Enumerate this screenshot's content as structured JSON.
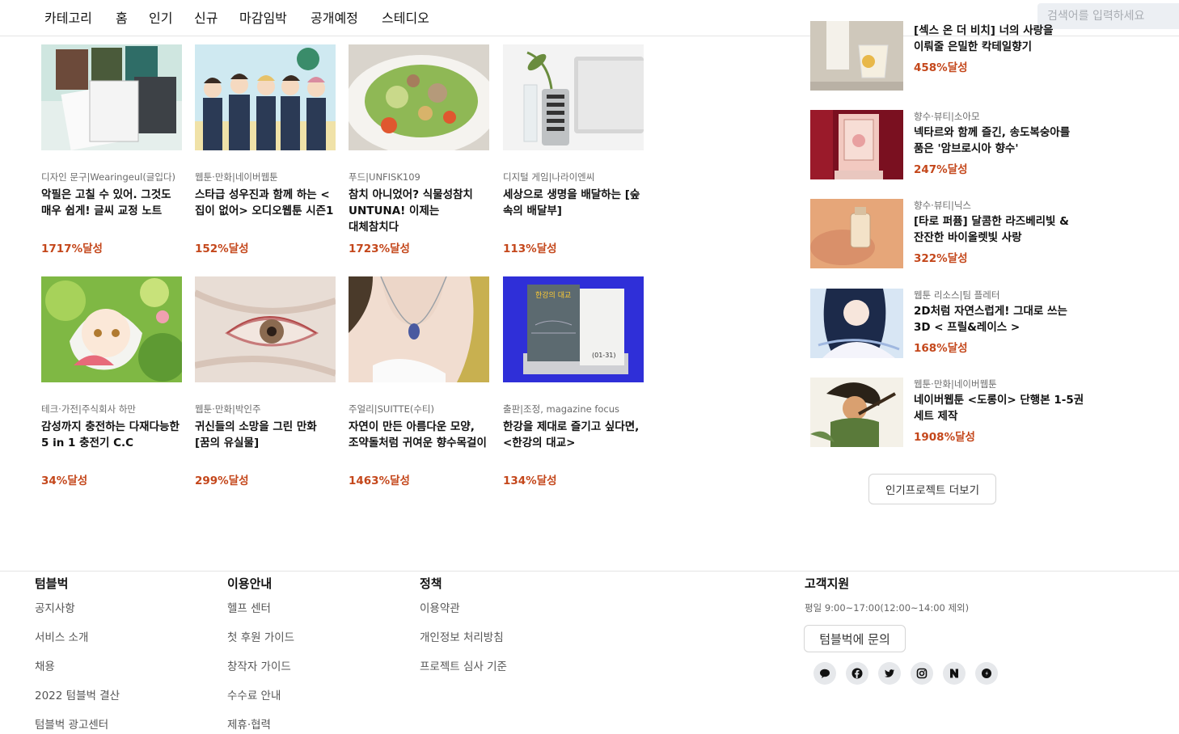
{
  "nav": {
    "items": [
      "카테고리",
      "홈",
      "인기",
      "신규",
      "마감임박",
      "공개예정",
      "스테디오"
    ],
    "search_placeholder": "검색어를 입력하세요"
  },
  "cards": [
    {
      "category": "디자인 문구|Wearingeul(글입다)",
      "title": "악필은 고칠 수 있어. 그것도 매우 쉽게! 글씨 교정 노트",
      "rate": "1717%달성"
    },
    {
      "category": "웹툰·만화|네이버웹툰",
      "title": "스타급 성우진과 함께 하는 <집이 없어> 오디오웹툰 시즌1",
      "rate": "152%달성"
    },
    {
      "category": "푸드|UNFISK109",
      "title": "참치 아니었어? 식물성참치 UNTUNA! 이제는 대체참치다",
      "rate": "1723%달성"
    },
    {
      "category": "디지털 게임|나라이엔씨",
      "title": "세상으로 생명을 배달하는 [숲 속의 배달부]",
      "rate": "113%달성"
    },
    {
      "category": "테크·가전|주식회사 하만",
      "title": "감성까지 충전하는 다재다능한 5 in 1 충전기 C.C",
      "rate": "34%달성"
    },
    {
      "category": "웹툰·만화|박인주",
      "title": "귀신들의 소망을 그린 만화 [꿈의 유실물]",
      "rate": "299%달성"
    },
    {
      "category": "주얼리|SUITTE(수티)",
      "title": "자연이 만든 아름다운 모양, 조약돌처럼 귀여운 향수목걸이",
      "rate": "1463%달성"
    },
    {
      "category": "출판|조정, magazine focus",
      "title": "한강을 제대로 즐기고 싶다면, <한강의 대교>",
      "rate": "134%달성"
    }
  ],
  "popular": [
    {
      "category": "",
      "title": "[섹스 온 더 비치] 너의 사랑을 이뤄줄 은밀한 칵테일향기",
      "rate": "458%달성"
    },
    {
      "category": "향수·뷰티|소아모",
      "title": "넥타르와 함께 즐긴, 송도복숭아를 품은 '암브로시아 향수'",
      "rate": "247%달성"
    },
    {
      "category": "향수·뷰티|닉스",
      "title": "[타로 퍼퓸] 달콤한 라즈베리빛 & 잔잔한 바이올렛빛 사랑",
      "rate": "322%달성"
    },
    {
      "category": "웹툰 리소스|팀 플레터",
      "title": "2D처럼 자연스럽게! 그대로 쓰는 3D < 프릴&레이스 >",
      "rate": "168%달성"
    },
    {
      "category": "웹툰·만화|네이버웹툰",
      "title": "네이버웹툰 <도롱이> 단행본 1-5권 세트 제작",
      "rate": "1908%달성"
    }
  ],
  "more_button": "인기프로젝트 더보기",
  "footer": {
    "col1": {
      "title": "텀블벅",
      "links": [
        "공지사항",
        "서비스 소개",
        "채용",
        "2022 텀블벅 결산",
        "텀블벅 광고센터"
      ]
    },
    "col2": {
      "title": "이용안내",
      "links": [
        "헬프 센터",
        "첫 후원 가이드",
        "창작자 가이드",
        "수수료 안내",
        "제휴·협력"
      ]
    },
    "col3": {
      "title": "정책",
      "links": [
        "이용약관",
        "개인정보 처리방침",
        "프로젝트 심사 기준"
      ]
    },
    "support": {
      "title": "고객지원",
      "hours": "평일 9:00~17:00(12:00~14:00 제외)",
      "ask_button": "텀블벅에 문의"
    },
    "social_icons": [
      "kakao-icon",
      "facebook-icon",
      "twitter-icon",
      "instagram-icon",
      "naver-icon",
      "brunch-icon"
    ]
  },
  "colors": {
    "accent": "#c4471b",
    "muted": "#6b6b6b"
  }
}
